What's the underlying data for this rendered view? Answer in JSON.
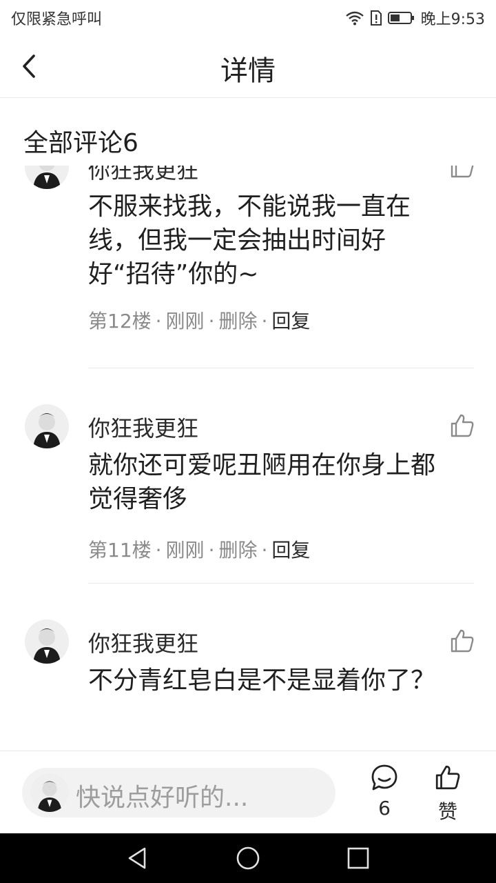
{
  "statusbar": {
    "left_text": "仅限紧急呼叫",
    "time": "晚上9:53"
  },
  "nav": {
    "title": "详情"
  },
  "comments_section": {
    "title": "全部评论6"
  },
  "comments": [
    {
      "name": "你狂我更狂",
      "text": "不服来找我，不能说我一直在线，但我一定会抽出时间好好“招待”你的~",
      "floor": "第12楼",
      "time": "刚刚",
      "delete": "删除",
      "reply": "回复"
    },
    {
      "name": "你狂我更狂",
      "text": "就你还可爱呢丑陋用在你身上都觉得奢侈",
      "floor": "第11楼",
      "time": "刚刚",
      "delete": "删除",
      "reply": "回复"
    },
    {
      "name": "你狂我更狂",
      "text": "不分青红皂白是不是显着你了？",
      "floor": "",
      "time": "",
      "delete": "",
      "reply": ""
    }
  ],
  "bottom": {
    "placeholder": "快说点好听的...",
    "comment_count": "6",
    "like_label": "赞"
  },
  "meta": {
    "separator": "·"
  }
}
